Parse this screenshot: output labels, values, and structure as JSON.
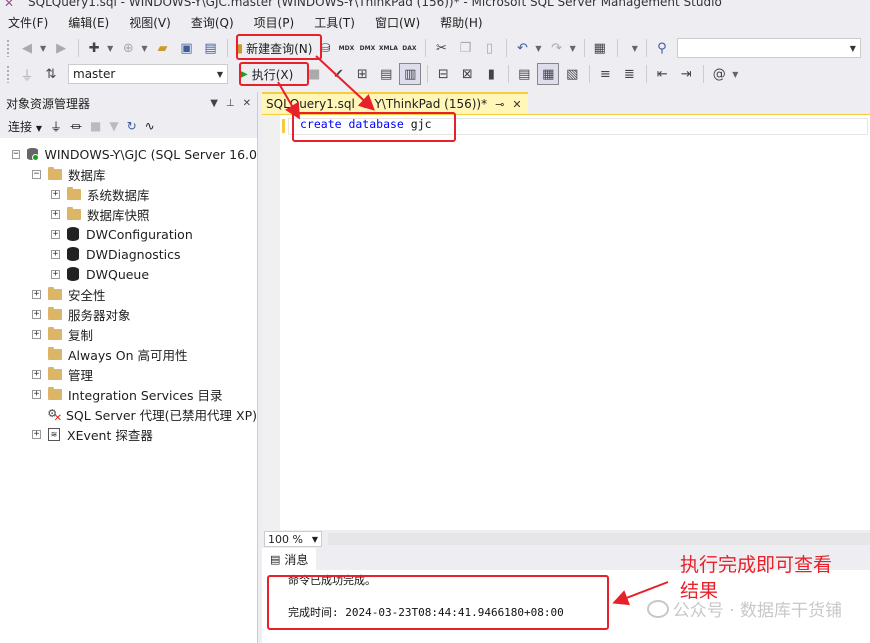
{
  "window": {
    "title": "SQLQuery1.sql - WINDOWS-Y\\GJC.master (WINDOWS-Y\\ThinkPad (156))* - Microsoft SQL Server Management Studio"
  },
  "menu": [
    "文件(F)",
    "编辑(E)",
    "视图(V)",
    "查询(Q)",
    "项目(P)",
    "工具(T)",
    "窗口(W)",
    "帮助(H)"
  ],
  "toolbar": {
    "new_query_label": "新建查询(N)",
    "mini_icons": [
      "MDX",
      "DMX",
      "XMLA",
      "DAX"
    ],
    "database_select": "master",
    "execute_label": "执行(X)"
  },
  "object_explorer": {
    "title": "对象资源管理器",
    "connect_label": "连接",
    "server": "WINDOWS-Y\\GJC (SQL Server 16.0",
    "databases": "数据库",
    "system_databases": "系统数据库",
    "db_snapshots": "数据库快照",
    "db1": "DWConfiguration",
    "db2": "DWDiagnostics",
    "db3": "DWQueue",
    "security": "安全性",
    "server_objects": "服务器对象",
    "replication": "复制",
    "always_on": "Always On 高可用性",
    "management": "管理",
    "integration": "Integration Services 目录",
    "agent": "SQL Server 代理(已禁用代理 XP)",
    "xevent": "XEvent 探查器"
  },
  "editor": {
    "tab_label": "SQLQuery1.sql -...Y\\ThinkPad (156))*",
    "code_keyword": "create database",
    "code_ident": "gjc",
    "zoom": "100 %"
  },
  "results": {
    "tab_label": "消息",
    "line1": "命令已成功完成。",
    "line2": "完成时间: 2024-03-23T08:44:41.9466180+08:00"
  },
  "annotation": {
    "line1": "执行完成即可查看",
    "line2": "结果"
  },
  "watermark": "公众号 · 数据库干货铺",
  "colors": {
    "highlight": "#e8202a",
    "tab_active": "#fff6b8",
    "keyword": "#0000ff"
  }
}
